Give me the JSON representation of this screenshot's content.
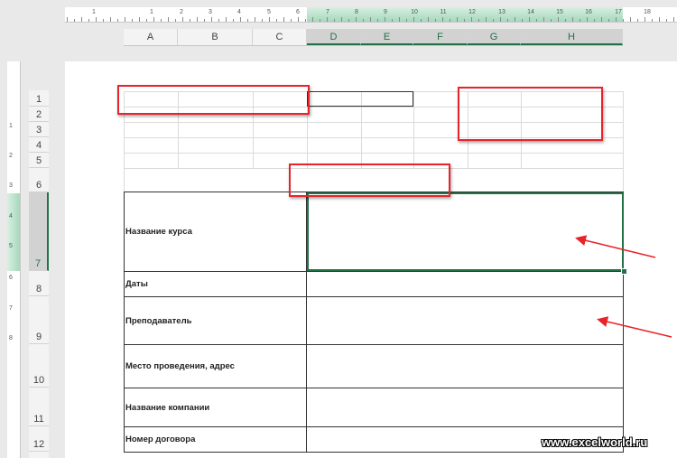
{
  "ruler": {
    "top_numbers": [
      "1",
      "1",
      "2",
      "3",
      "4",
      "5",
      "6",
      "7",
      "8",
      "9",
      "10",
      "11",
      "12",
      "13",
      "14",
      "15",
      "16",
      "17",
      "18"
    ],
    "left_numbers": [
      "1",
      "2",
      "3",
      "4",
      "5",
      "6",
      "7",
      "8"
    ]
  },
  "columns": [
    "A",
    "B",
    "C",
    "D",
    "E",
    "F",
    "G",
    "H"
  ],
  "rows": [
    "1",
    "2",
    "3",
    "4",
    "5",
    "6",
    "7",
    "8",
    "9",
    "10",
    "11",
    "12"
  ],
  "table": {
    "labels": {
      "course": "Название курса",
      "dates": "Даты",
      "teacher": "Преподаватель",
      "venue": "Место проведения, адрес",
      "company": "Название компании",
      "contract": "Номер договора"
    }
  },
  "watermark": "www.excelworld.ru",
  "colors": {
    "accent": "#217346",
    "annotation": "#e8232a"
  }
}
